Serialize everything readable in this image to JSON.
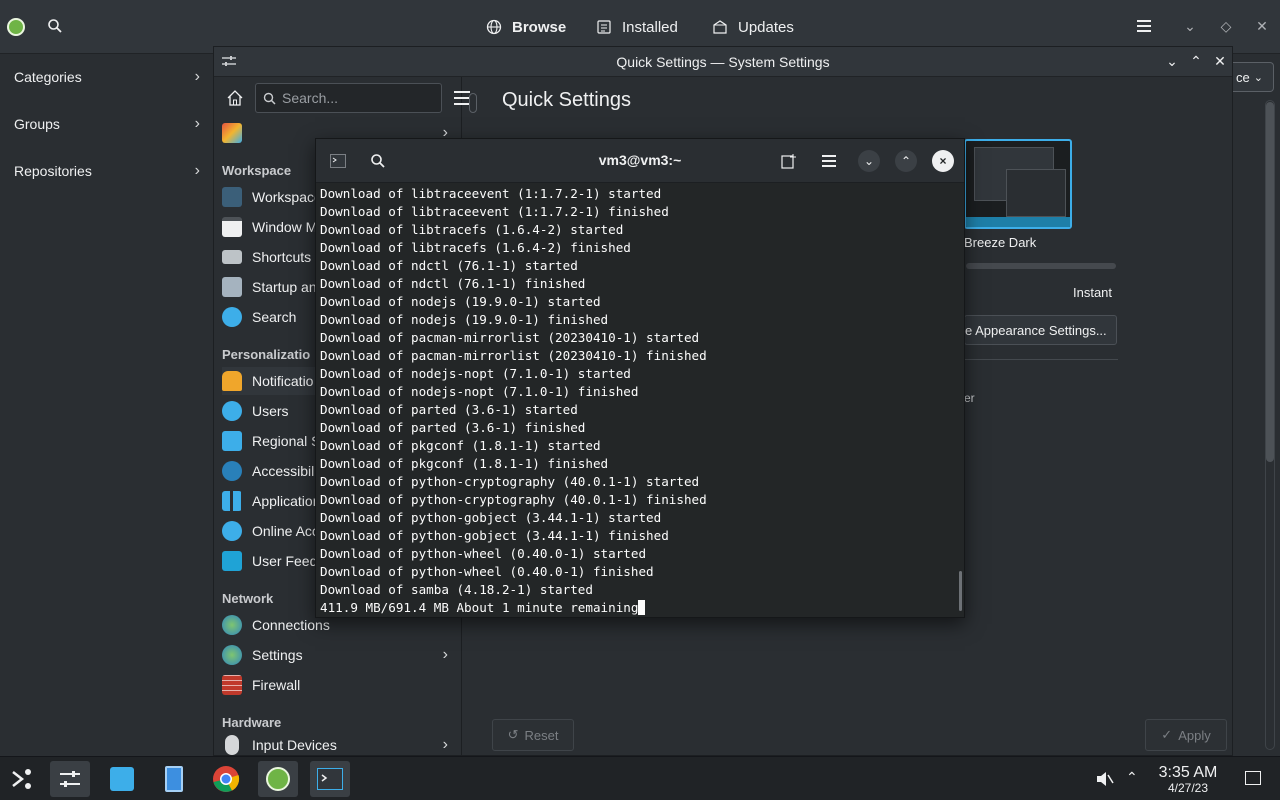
{
  "discover": {
    "tabs": [
      {
        "label": "Browse",
        "icon": "globe-icon"
      },
      {
        "label": "Installed",
        "icon": "list-icon"
      },
      {
        "label": "Updates",
        "icon": "updates-icon"
      }
    ],
    "sidebar": [
      {
        "label": "Categories"
      },
      {
        "label": "Groups"
      },
      {
        "label": "Repositories"
      }
    ],
    "combo_partial": "ce"
  },
  "settings": {
    "window_title": "Quick Settings — System Settings",
    "search_placeholder": "Search...",
    "page_title": "Quick Settings",
    "groups": {
      "workspace": "Workspace",
      "personalization": "Personalizatio",
      "network": "Network",
      "hardware": "Hardware"
    },
    "items": {
      "workspace": "Workspace",
      "window": "Window M",
      "shortcuts": "Shortcuts",
      "startup": "Startup an",
      "search": "Search",
      "notifications": "Notificatio",
      "users": "Users",
      "regional": "Regional S",
      "accessibility": "Accessibili",
      "applications": "Application",
      "online": "Online Acc",
      "feedback": "User Feedl",
      "connections": "Connections",
      "net_settings": "Settings",
      "firewall": "Firewall",
      "input": "Input Devices"
    },
    "theme_label": "Breeze Dark",
    "animation_label": "Instant",
    "more_appearance": "e Appearance Settings...",
    "partial_text": "er",
    "reset": "Reset",
    "apply": "Apply"
  },
  "konsole": {
    "title": "vm3@vm3:~",
    "lines": [
      "Download of libtraceevent (1:1.7.2-1) started",
      "Download of libtraceevent (1:1.7.2-1) finished",
      "Download of libtracefs (1.6.4-2) started",
      "Download of libtracefs (1.6.4-2) finished",
      "Download of ndctl (76.1-1) started",
      "Download of ndctl (76.1-1) finished",
      "Download of nodejs (19.9.0-1) started",
      "Download of nodejs (19.9.0-1) finished",
      "Download of pacman-mirrorlist (20230410-1) started",
      "Download of pacman-mirrorlist (20230410-1) finished",
      "Download of nodejs-nopt (7.1.0-1) started",
      "Download of nodejs-nopt (7.1.0-1) finished",
      "Download of parted (3.6-1) started",
      "Download of parted (3.6-1) finished",
      "Download of pkgconf (1.8.1-1) started",
      "Download of pkgconf (1.8.1-1) finished",
      "Download of python-cryptography (40.0.1-1) started",
      "Download of python-cryptography (40.0.1-1) finished",
      "Download of python-gobject (3.44.1-1) started",
      "Download of python-gobject (3.44.1-1) finished",
      "Download of python-wheel (0.40.0-1) started",
      "Download of python-wheel (0.40.0-1) finished",
      "Download of samba (4.18.2-1) started"
    ],
    "progress_line": "411.9 MB/691.4 MB About 1 minute remaining"
  },
  "taskbar": {
    "apps": [
      "application-launcher",
      "system-settings",
      "discover-store",
      "dolphin-files",
      "chrome",
      "discover",
      "konsole"
    ],
    "time": "3:35 AM",
    "date": "4/27/23"
  },
  "colors": {
    "accent": "#3daee9",
    "window_bg": "#2a2e32",
    "terminal_bg": "#232627"
  }
}
